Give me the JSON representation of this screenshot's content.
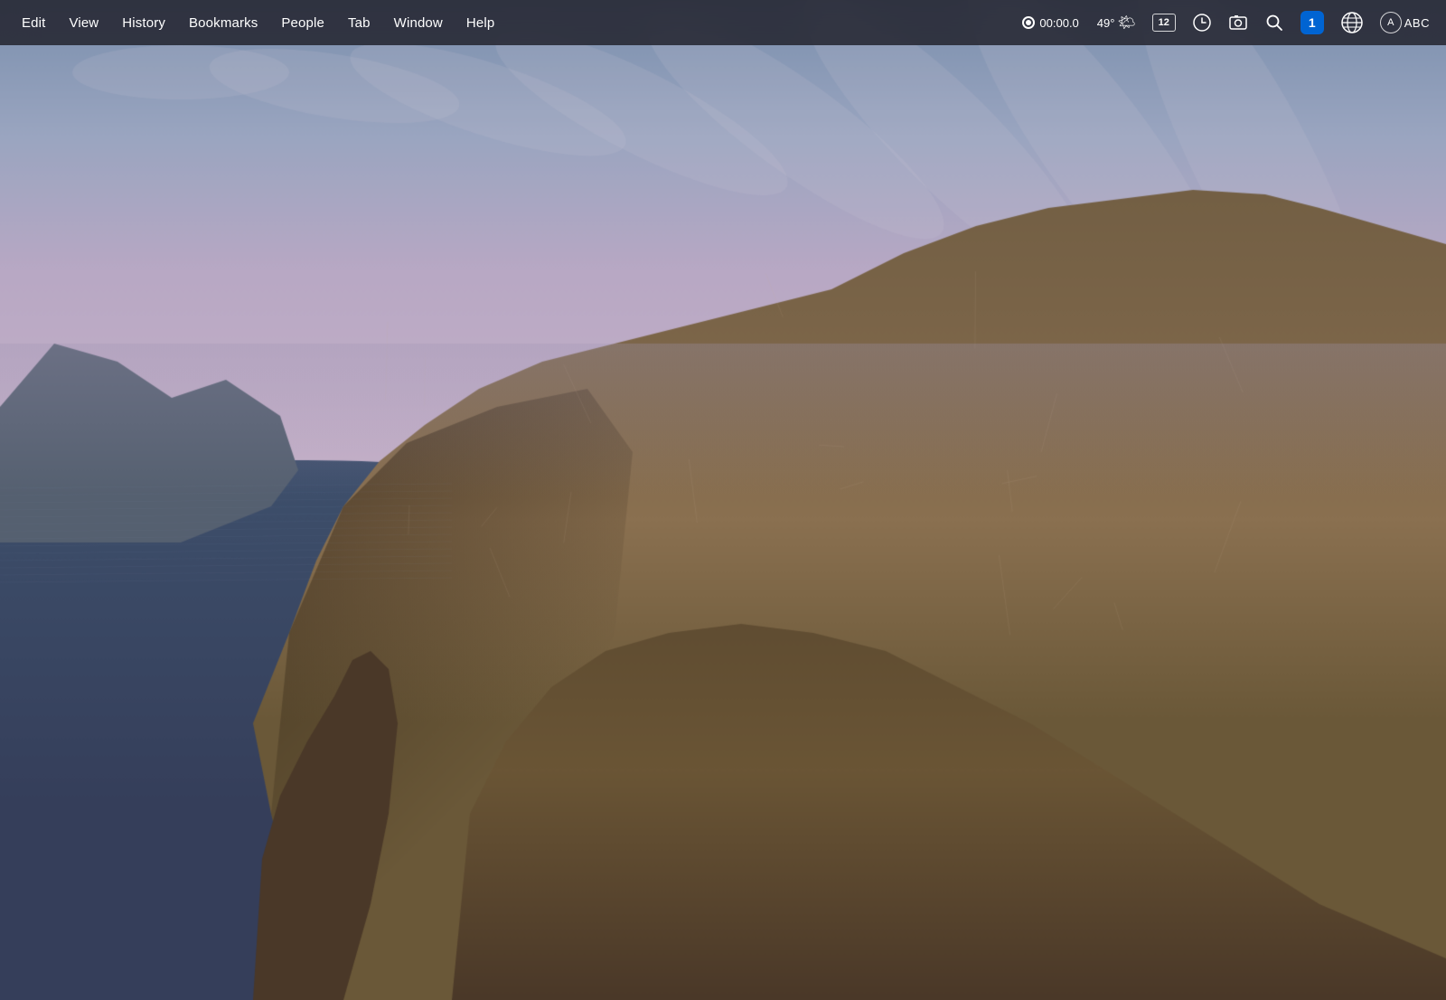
{
  "menubar": {
    "left_items": [
      {
        "id": "edit",
        "label": "Edit"
      },
      {
        "id": "view",
        "label": "View"
      },
      {
        "id": "history",
        "label": "History"
      },
      {
        "id": "bookmarks",
        "label": "Bookmarks"
      },
      {
        "id": "people",
        "label": "People"
      },
      {
        "id": "tab",
        "label": "Tab"
      },
      {
        "id": "window",
        "label": "Window"
      },
      {
        "id": "help",
        "label": "Help"
      }
    ],
    "right_items": {
      "record_time": "00:00.0",
      "temperature": "49°",
      "tab_count": "12",
      "font_label": "ABC"
    }
  },
  "wallpaper": {
    "description": "macOS Catalina wallpaper - rocky coastline with mountains and sea",
    "sky_color_top": "#8b9bb8",
    "sky_color_bottom": "#b8a8c0",
    "sea_color": "#4a5a7a",
    "mountain_color": "#6b5a40",
    "rock_color": "#5a4a35"
  }
}
